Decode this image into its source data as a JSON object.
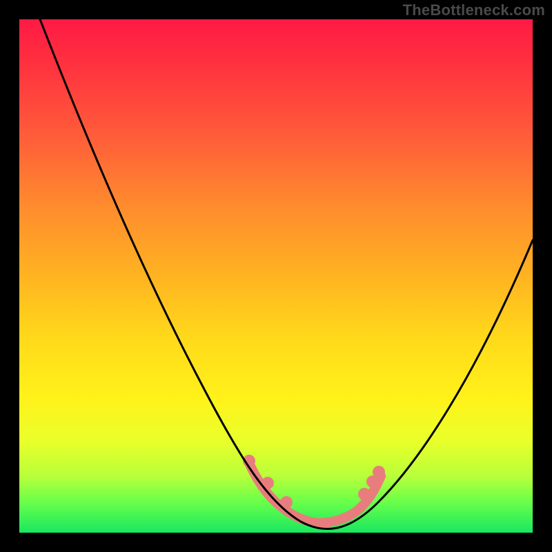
{
  "watermark": "TheBottleneck.com",
  "colors": {
    "marker": "#e97d7d",
    "curve": "#000000"
  },
  "chart_data": {
    "type": "line",
    "title": "",
    "xlabel": "",
    "ylabel": "",
    "xlim": [
      0,
      100
    ],
    "ylim": [
      0,
      100
    ],
    "grid": false,
    "series": [
      {
        "name": "bottleneck-curve",
        "x": [
          0,
          6,
          12,
          18,
          24,
          30,
          36,
          42,
          47,
          51,
          55,
          58,
          61,
          64,
          68,
          73,
          79,
          86,
          94,
          100
        ],
        "y": [
          100,
          88,
          77,
          66,
          55,
          45,
          35,
          26,
          17,
          10,
          5,
          2,
          1,
          2,
          5,
          12,
          22,
          34,
          48,
          58
        ]
      }
    ],
    "markers": {
      "name": "highlight-dots",
      "x": [
        45,
        49,
        52,
        58,
        62,
        65,
        67,
        69
      ],
      "y": [
        13,
        9,
        6,
        2,
        2,
        4,
        7,
        10
      ]
    },
    "gradient_stops": [
      {
        "pos": 0,
        "color": "#ff1a45"
      },
      {
        "pos": 50,
        "color": "#ffb321"
      },
      {
        "pos": 75,
        "color": "#fff21a"
      },
      {
        "pos": 100,
        "color": "#18e860"
      }
    ]
  }
}
